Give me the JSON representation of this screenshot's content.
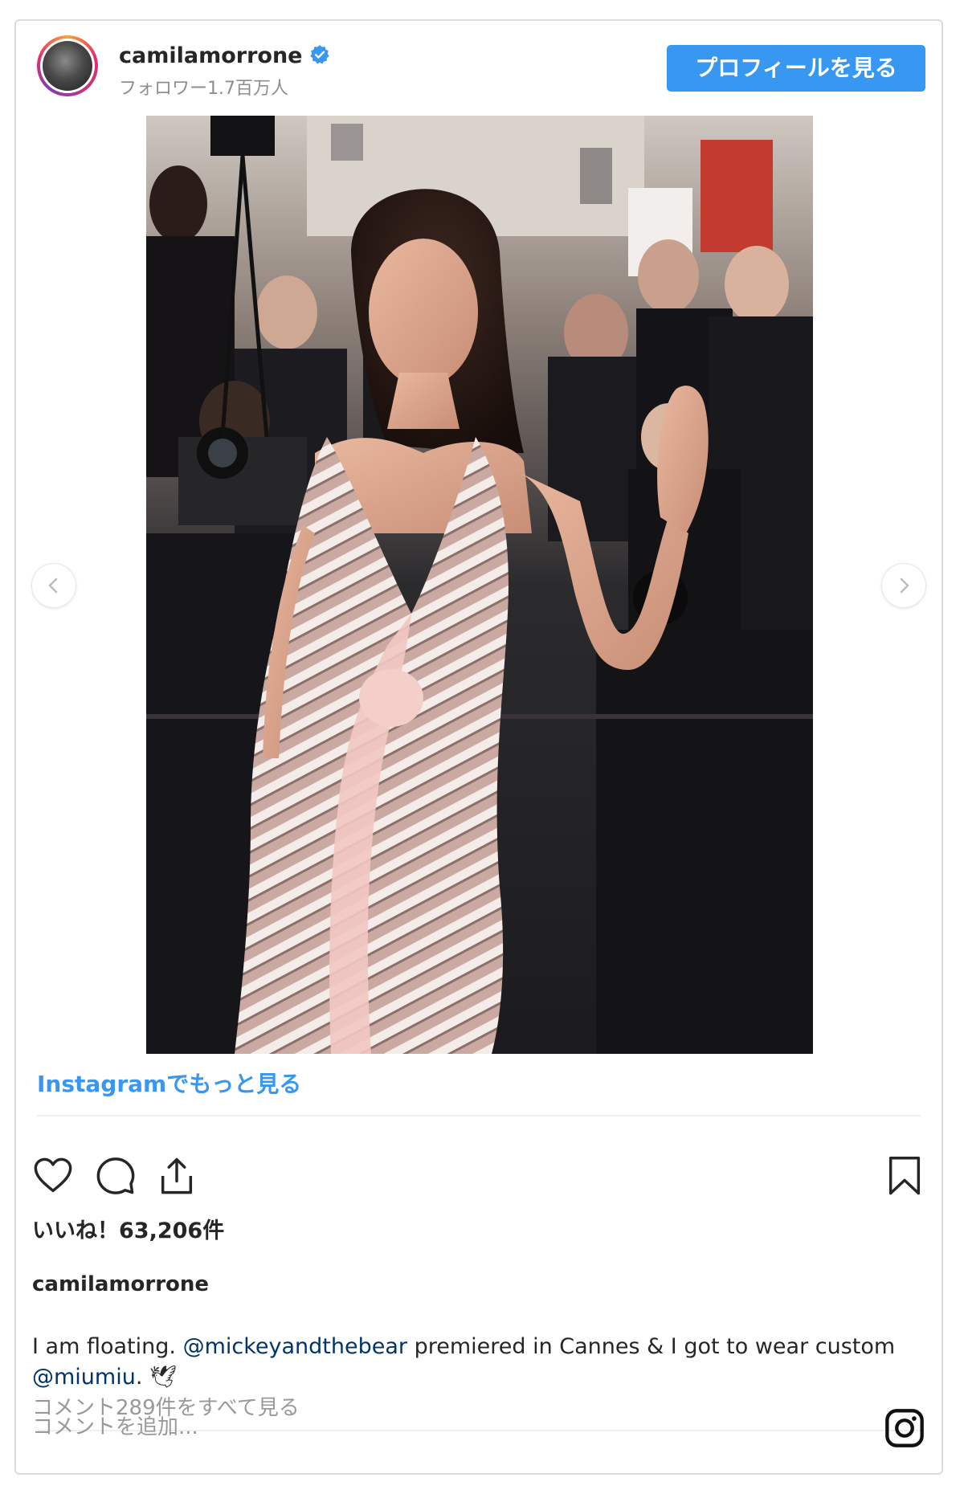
{
  "post": {
    "username": "camilamorrone",
    "followers": "フォロワー1.7百万人",
    "profile_button": "プロフィールを見る",
    "more_link": "Instagramでもっと見る",
    "likes": "いいね！63,206件",
    "caption_user": "camilamorrone",
    "caption_parts": [
      "I am floating. ",
      "@mickeyandthebear",
      " premiered in Cannes & I got to wear custom ",
      "@miumiu",
      ". 🕊"
    ],
    "view_comments": "コメント289件をすべて見る",
    "comment_placeholder": "コメントを追加..."
  },
  "icons": {
    "verified": "verified-badge-icon",
    "like": "heart-icon",
    "comment": "comment-bubble-icon",
    "share": "share-icon",
    "save": "bookmark-icon",
    "prev": "chevron-left-icon",
    "next": "chevron-right-icon",
    "logo": "instagram-logo-icon"
  },
  "colors": {
    "accent": "#3897f0",
    "mention": "#003569",
    "muted": "#8e8e8e"
  }
}
